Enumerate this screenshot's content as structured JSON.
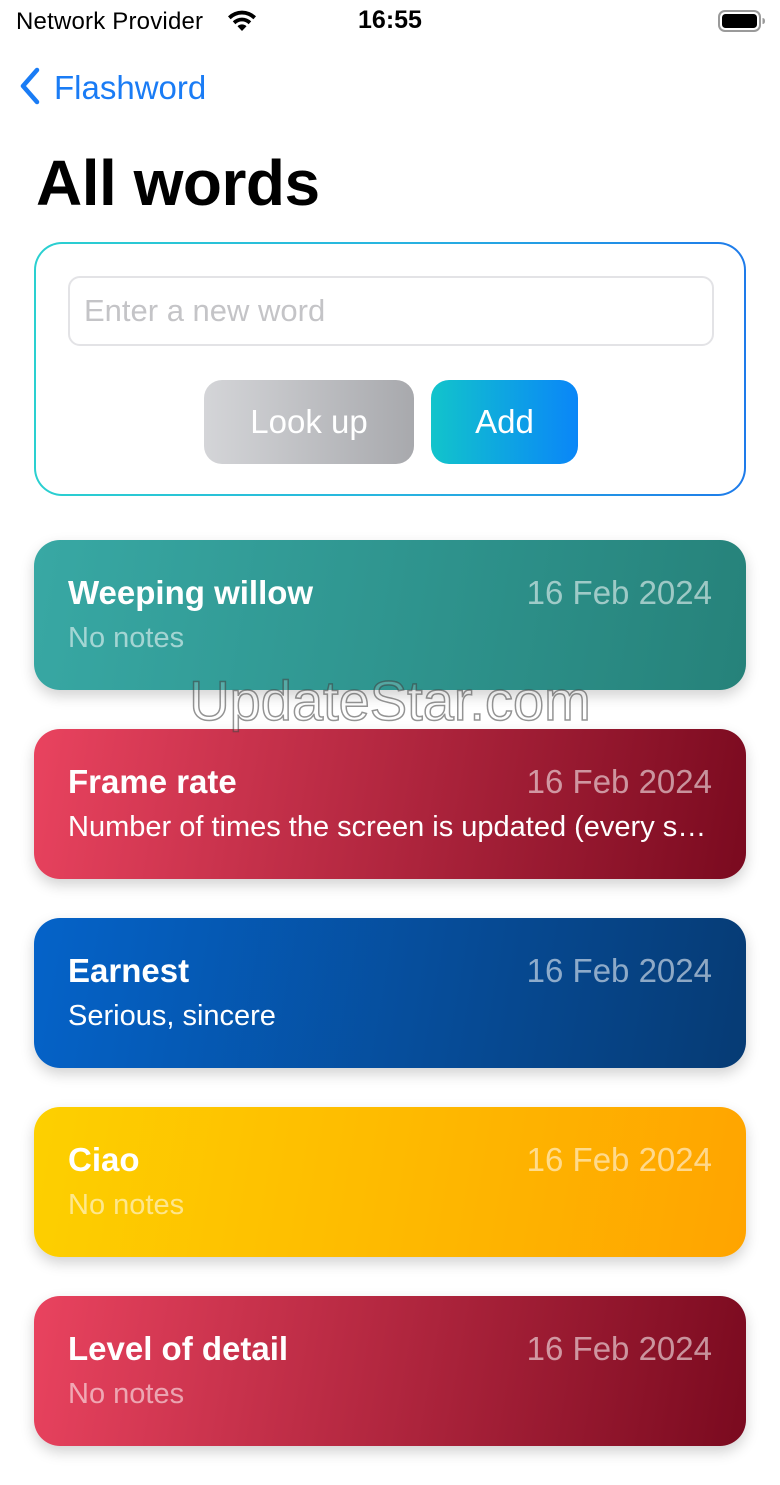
{
  "status_bar": {
    "carrier": "Network Provider",
    "time": "16:55"
  },
  "nav": {
    "back_label": "Flashword"
  },
  "page": {
    "title": "All words"
  },
  "entry": {
    "input_value": "",
    "input_placeholder": "Enter a new word",
    "lookup_label": "Look up",
    "add_label": "Add"
  },
  "words": [
    {
      "title": "Weeping willow",
      "date": "16 Feb 2024",
      "note": "No notes",
      "gradient": [
        "#38a8a4",
        "#26827a"
      ]
    },
    {
      "title": "Frame rate",
      "date": "16 Feb 2024",
      "note": "Number of times the screen is updated (every second)",
      "gradient": [
        "#e9435f",
        "#7a0a1f"
      ]
    },
    {
      "title": "Earnest",
      "date": "16 Feb 2024",
      "note": "Serious, sincere",
      "gradient": [
        "#0563c9",
        "#063b74"
      ]
    },
    {
      "title": "Ciao",
      "date": "16 Feb 2024",
      "note": "No notes",
      "gradient": [
        "#fdd000",
        "#ffa400"
      ]
    },
    {
      "title": "Level of detail",
      "date": "16 Feb 2024",
      "note": "No notes",
      "gradient": [
        "#e9435f",
        "#7a0a1f"
      ]
    }
  ],
  "watermark": "UpdateStar.com",
  "colors": {
    "accent_blue": "#1a7cf5"
  }
}
